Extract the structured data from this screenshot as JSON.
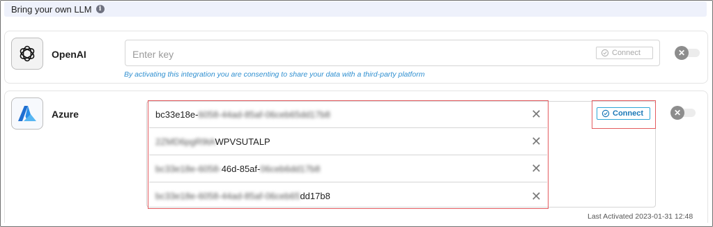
{
  "header": {
    "title": "Bring your own LLM",
    "info_icon": "info-icon"
  },
  "openai": {
    "name": "OpenAI",
    "logo_icon": "openai-logo-icon",
    "key_placeholder": "Enter key",
    "connect_label": "Connect",
    "consent": "By activating this integration you are consenting to share your data with a third-party platform",
    "toggle_on": false
  },
  "azure": {
    "name": "Azure",
    "logo_icon": "azure-logo-icon",
    "connect_label": "Connect",
    "toggle_on": false,
    "fields": [
      {
        "clear": "✕",
        "segments": [
          {
            "text": "bc33e18e-",
            "blur": false
          },
          {
            "text": "6058-44ad-85af-06ceb65dd17b8",
            "blur": true
          }
        ]
      },
      {
        "clear": "✕",
        "segments": [
          {
            "text": "2ZMD6pgR9tA",
            "blur": true
          },
          {
            "text": "WPVSUTALP",
            "blur": false
          }
        ]
      },
      {
        "clear": "✕",
        "segments": [
          {
            "text": "bc33e18e-6058-",
            "blur": true
          },
          {
            "text": "46d-85af-",
            "blur": false
          },
          {
            "text": "06ceb6dd17b8",
            "blur": true
          }
        ]
      },
      {
        "clear": "✕",
        "segments": [
          {
            "text": "bc33e18e-6058-44ad-85af-06ceb65",
            "blur": true
          },
          {
            "text": "dd17b8",
            "blur": false
          }
        ]
      }
    ],
    "last_activated": "Last Activated 2023-01-31 12:48"
  },
  "colors": {
    "accent": "#2ea6d7",
    "highlight": "#e35b5f",
    "link": "#2f8fd0"
  }
}
